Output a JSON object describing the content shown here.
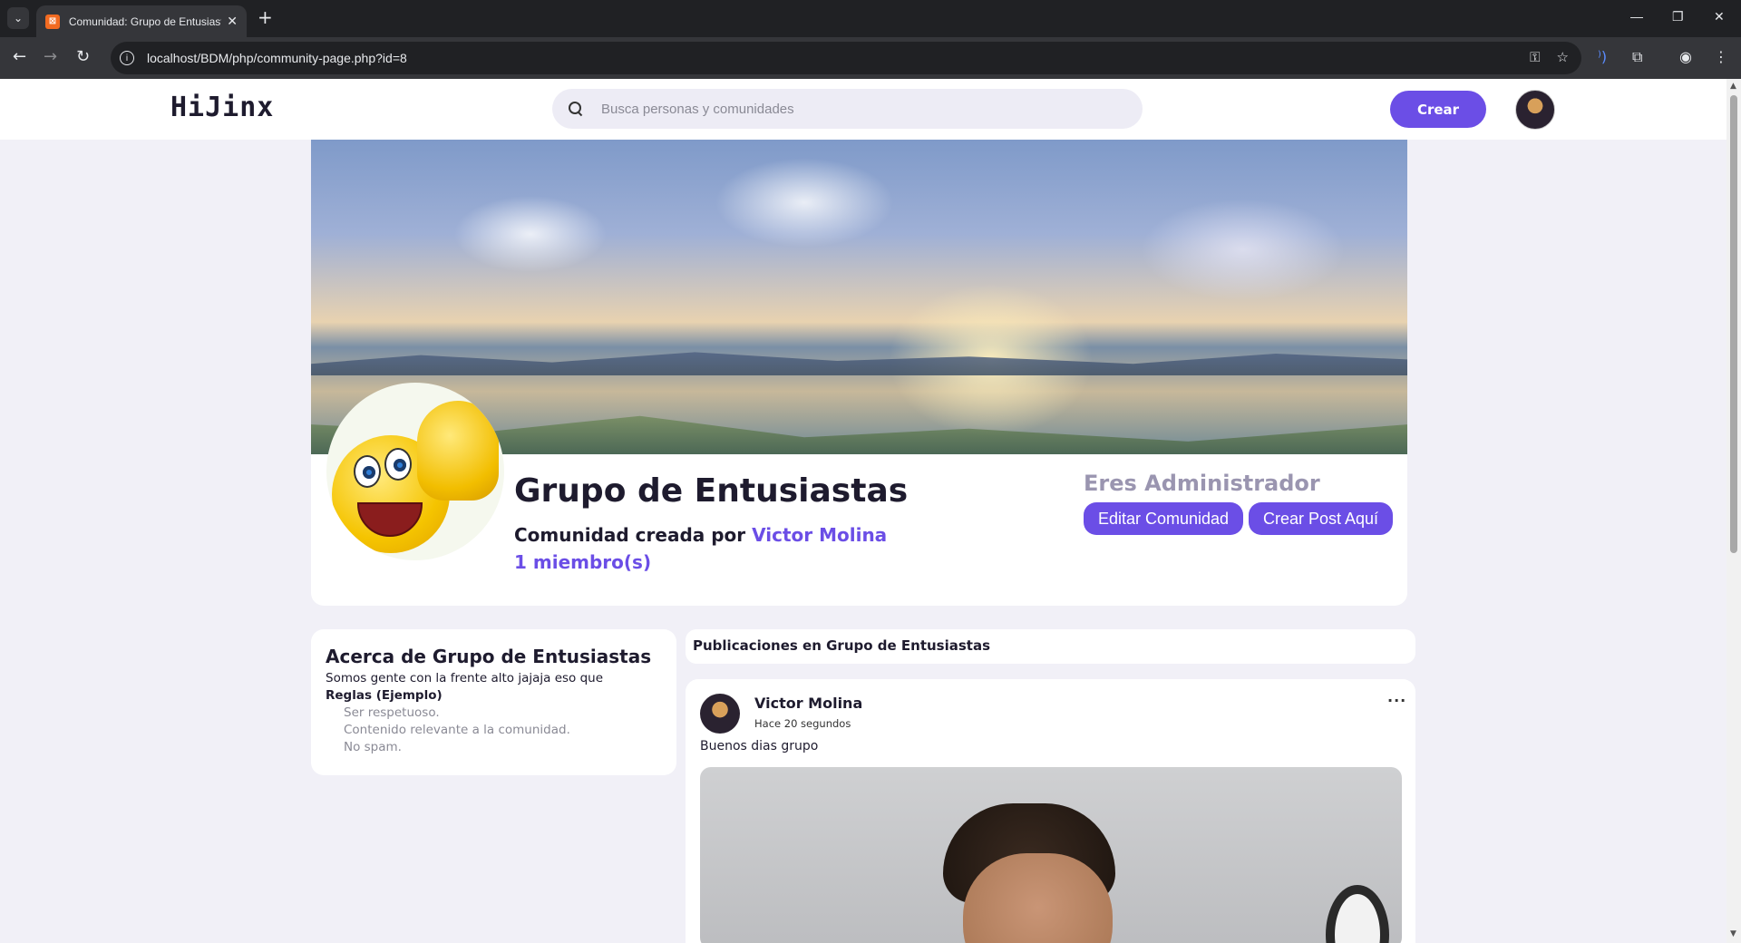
{
  "browser": {
    "tab_title": "Comunidad: Grupo de Entusiastas",
    "url": "localhost/BDM/php/community-page.php?id=8"
  },
  "header": {
    "logo": "HiJinx",
    "search_placeholder": "Busca personas y comunidades",
    "create_label": "Crear"
  },
  "community": {
    "name": "Grupo de Entusiastas",
    "created_by_prefix": "Comunidad creada por",
    "creator": "Victor Molina",
    "members": "1 miembro(s)",
    "admin_label": "Eres Administrador",
    "edit_label": "Editar Comunidad",
    "create_post_label": "Crear Post Aquí"
  },
  "about": {
    "title": "Acerca de Grupo de Entusiastas",
    "description": "Somos gente con la frente alto jajaja eso que",
    "rules_title": "Reglas (Ejemplo)",
    "rules": [
      "Ser respetuoso.",
      "Contenido relevante a la comunidad.",
      "No spam."
    ]
  },
  "posts": {
    "header": "Publicaciones en Grupo de Entusiastas",
    "items": [
      {
        "author": "Victor Molina",
        "time": "Hace 20 segundos",
        "text": "Buenos dias grupo",
        "menu": "···"
      }
    ]
  },
  "icons": {
    "favicon": "xampp-icon",
    "avatar": "user-avatar"
  },
  "colors": {
    "accent": "#6b4ee6",
    "background": "#f1f0f7",
    "admin_label": "#9a95b0"
  }
}
